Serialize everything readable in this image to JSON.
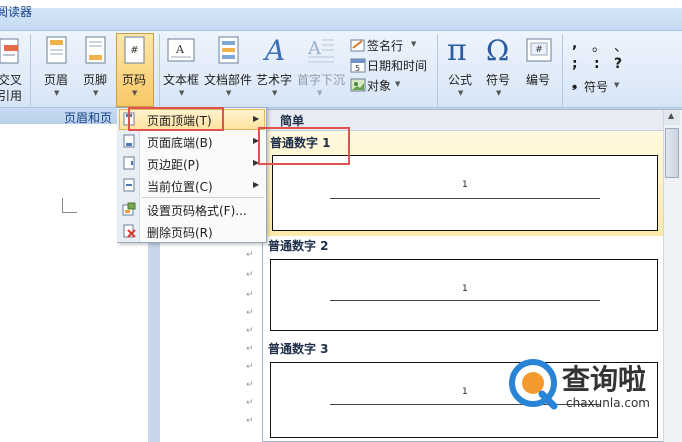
{
  "window": {
    "title_fragment": "阅读器"
  },
  "ribbon": {
    "left_cut_top": "交叉",
    "left_cut_bottom": "引用",
    "header_btn": "页眉",
    "footer_btn": "页脚",
    "pagenum_btn": "页码",
    "textbox_btn": "文本框",
    "docparts_btn": "文档部件",
    "wordart_btn": "艺术字",
    "dropcap_btn": "首字下沉",
    "signature_line": "签名行",
    "datetime": "日期和时间",
    "object": "对象",
    "equation_btn": "公式",
    "symbol_btn": "符号",
    "numbering_btn": "编号",
    "special_symbol": "符号",
    "group_label": "页眉和页"
  },
  "menu": {
    "items": [
      {
        "label": "页面顶端(T)",
        "has_submenu": true
      },
      {
        "label": "页面底端(B)",
        "has_submenu": true
      },
      {
        "label": "页边距(P)",
        "has_submenu": true
      },
      {
        "label": "当前位置(C)",
        "has_submenu": true
      },
      {
        "label": "设置页码格式(F)...",
        "has_submenu": false
      },
      {
        "label": "删除页码(R)",
        "has_submenu": false
      }
    ]
  },
  "gallery": {
    "section_header": "简单",
    "items": [
      {
        "title": "普通数字 1",
        "number": "1"
      },
      {
        "title": "普通数字 2",
        "number": "1"
      },
      {
        "title": "普通数字 3",
        "number": "1"
      }
    ]
  },
  "watermark": {
    "brand": "查询啦",
    "domain": "chaxunla.com"
  },
  "colors": {
    "highlight": "#fde3a0",
    "annotation": "#e05252",
    "ribbon_text": "#15428b"
  }
}
